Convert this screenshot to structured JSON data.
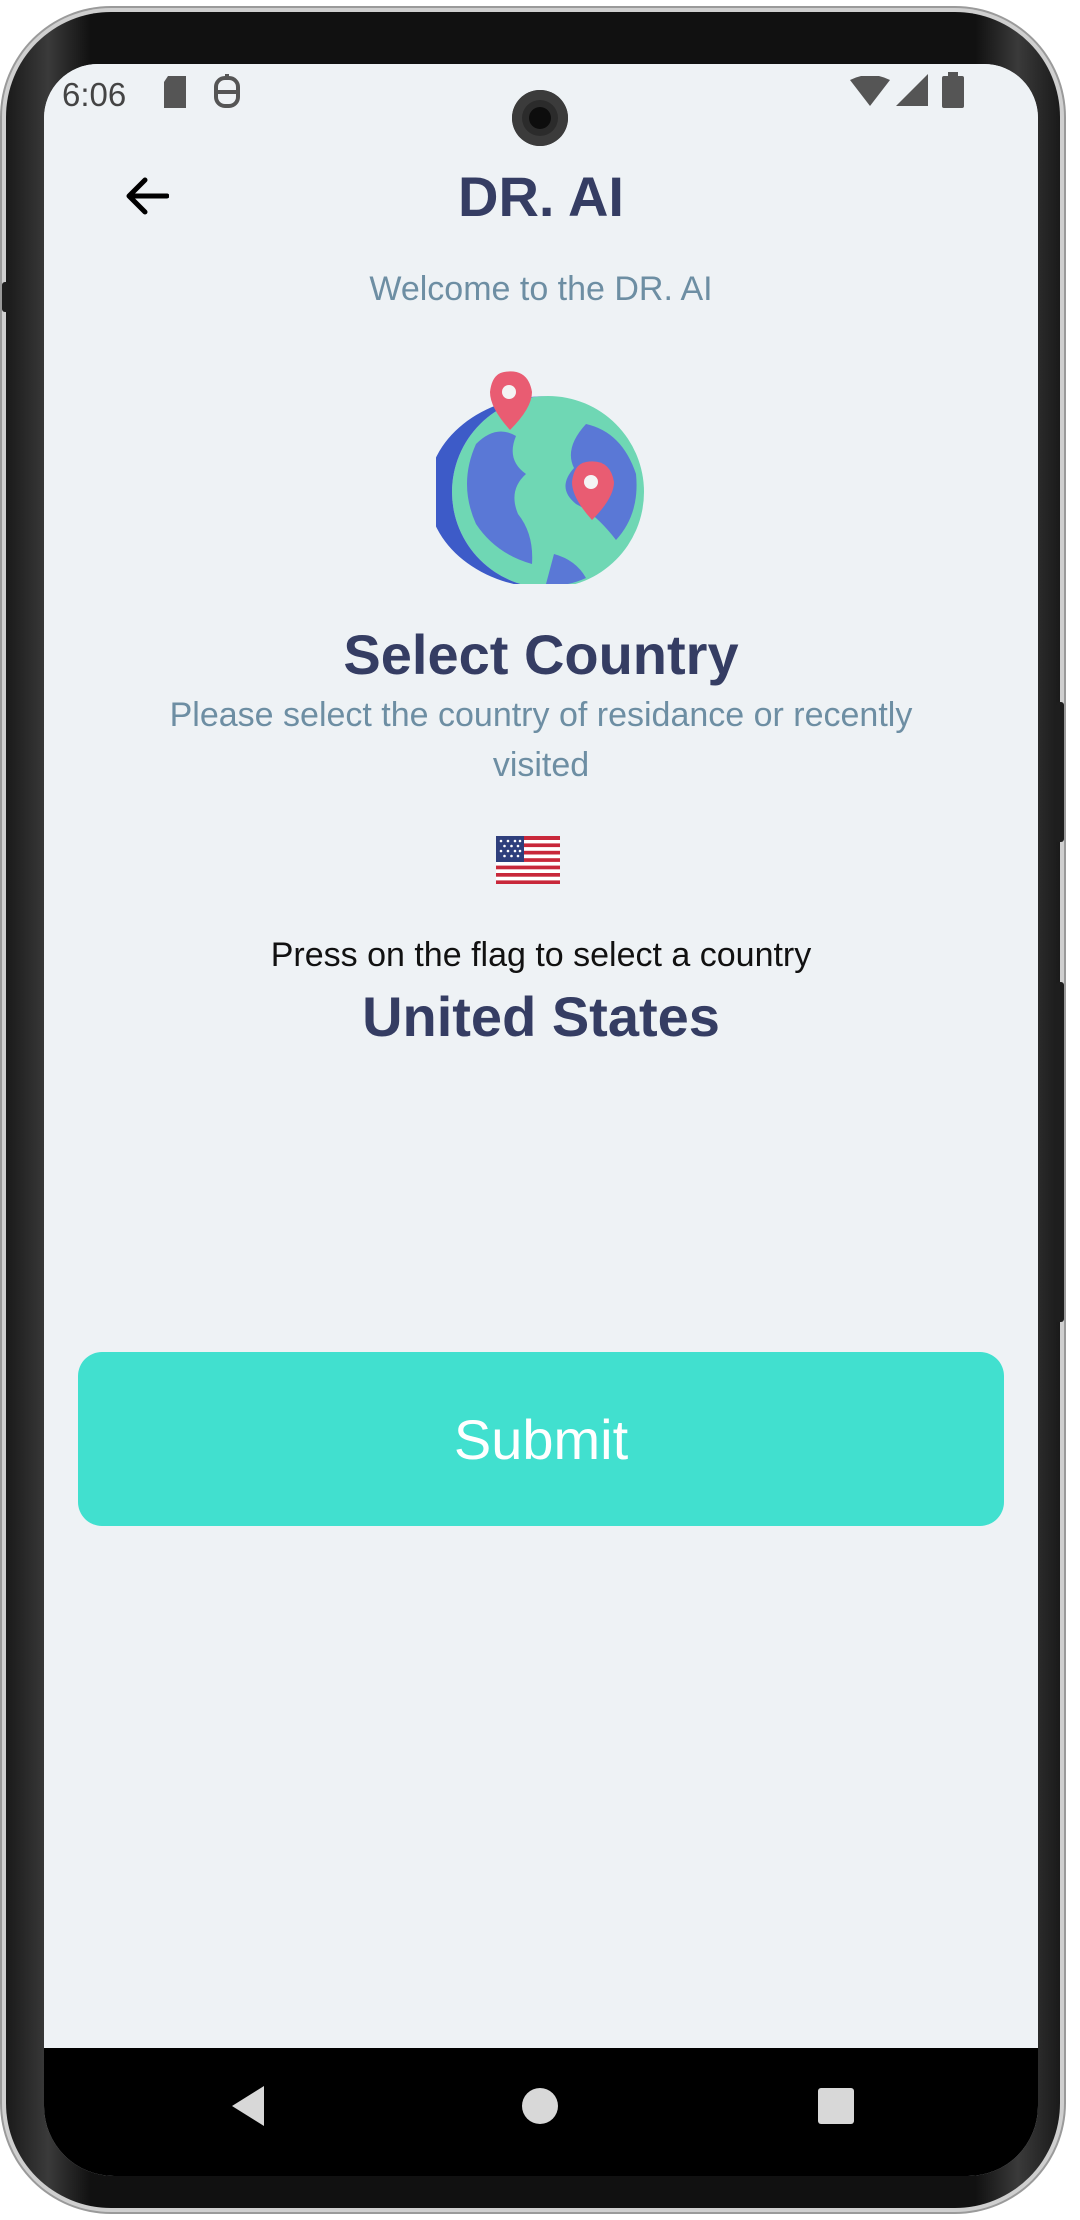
{
  "status_bar": {
    "time": "6:06",
    "icons": [
      "sd-card-icon",
      "assistant-icon",
      "wifi-icon",
      "signal-icon",
      "battery-icon"
    ]
  },
  "header": {
    "title": "DR. AI",
    "back_icon": "arrow-left-icon"
  },
  "welcome_text": "Welcome to the DR. AI",
  "illustration": "globe-with-pins-icon",
  "select": {
    "title": "Select Country",
    "description": "Please select the country of residance or recently visited"
  },
  "flag": {
    "icon": "us-flag-icon"
  },
  "hint": "Press on the flag to select a country",
  "country_name": "United States",
  "submit_label": "Submit",
  "nav": {
    "back": "nav-back-icon",
    "home": "nav-home-icon",
    "recents": "nav-recents-icon"
  },
  "colors": {
    "background": "#eef2f5",
    "title": "#353d63",
    "subtitle": "#6d8ea3",
    "accent": "#41e0cf"
  }
}
